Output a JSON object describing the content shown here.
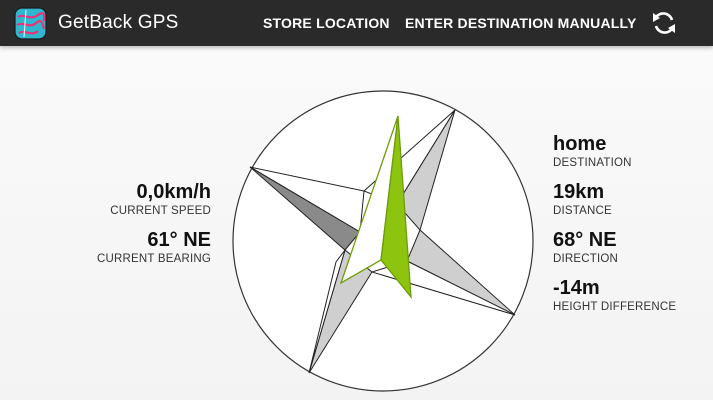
{
  "app": {
    "title": "GetBack GPS",
    "icon": "app-logo-icon"
  },
  "actions": {
    "store_location": "STORE LOCATION",
    "enter_destination": "ENTER DESTINATION MANUALLY",
    "refresh_icon": "refresh-icon"
  },
  "left_panel": {
    "speed_value": "0,0km/h",
    "speed_label": "CURRENT SPEED",
    "bearing_value": "61° NE",
    "bearing_label": "CURRENT BEARING"
  },
  "right_panel": {
    "destination_value": "home",
    "destination_label": "DESTINATION",
    "distance_value": "19km",
    "distance_label": "DISTANCE",
    "direction_value": "68° NE",
    "direction_label": "DIRECTION",
    "height_value": "-14m",
    "height_label": "HEIGHT DIFFERENCE"
  },
  "colors": {
    "appbar": "#2a2a2a",
    "arrow_green": "#8cc40f",
    "compass_dark": "#8a8a8a",
    "compass_light": "#cfcfcf"
  }
}
